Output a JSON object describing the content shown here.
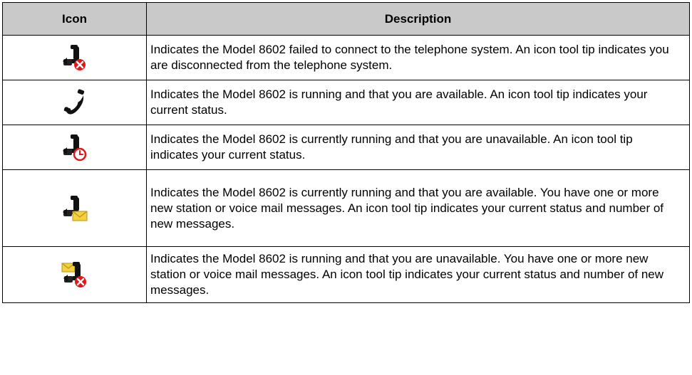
{
  "table": {
    "headers": {
      "icon": "Icon",
      "description": "Description"
    },
    "rows": [
      {
        "icon": "phone-disconnected-icon",
        "description": "Indicates the Model 8602 failed to connect to the telephone system. An icon tool tip indicates you are disconnected from the telephone system."
      },
      {
        "icon": "phone-available-icon",
        "description": "Indicates the Model 8602 is running and that you are available. An icon tool tip indicates your current status."
      },
      {
        "icon": "phone-unavailable-clock-icon",
        "description": "Indicates the Model 8602 is currently running and that you are unavailable. An icon tool tip indicates your current status."
      },
      {
        "icon": "phone-available-message-icon",
        "description": "Indicates the Model 8602 is currently running and that you are available. You have one or more new station or voice mail messages. An icon tool tip indicates your current status and number of new messages."
      },
      {
        "icon": "phone-unavailable-message-icon",
        "description": "Indicates the Model 8602 is running and that you are unavailable. You have one or more new station or voice mail messages. An icon tool tip indicates your current status and number of new messages."
      }
    ]
  },
  "colors": {
    "header_background": "#c9c9c9",
    "border": "#000000",
    "handset": "#111111",
    "alert_red": "#e0181b",
    "envelope_yellow": "#f4d03f"
  }
}
